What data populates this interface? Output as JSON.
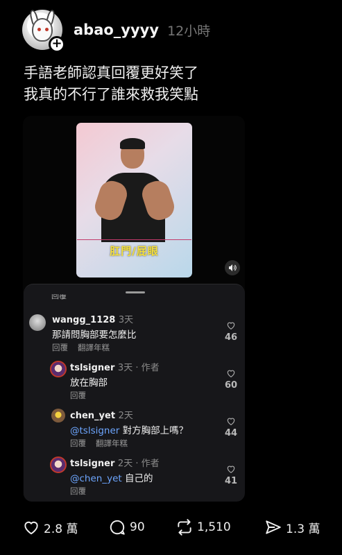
{
  "post": {
    "username": "abao_yyyy",
    "time": "12小時",
    "text_line1": "手語老師認真回覆更好笑了",
    "text_line2": "我真的不行了誰來救我笑點"
  },
  "video": {
    "caption": "肛門/屁眼"
  },
  "comments_sheet": {
    "cut_label": "回覆",
    "comments": [
      {
        "user": "wangg_1128",
        "meta": "3天",
        "text": "那請問胸部要怎麼比",
        "reply": "回覆",
        "translate": "翻譯年糕",
        "likes": "46"
      },
      {
        "user": "tslsigner",
        "meta": "3天 · 作者",
        "text": "放在胸部",
        "reply": "回覆",
        "likes": "60"
      },
      {
        "user": "chen_yet",
        "meta": "2天",
        "mention": "@tslsigner",
        "text": " 對方胸部上嗎？",
        "reply": "回覆",
        "translate": "翻譯年糕",
        "likes": "44"
      },
      {
        "user": "tslsigner",
        "meta": "2天 · 作者",
        "mention": "@chen_yet",
        "text": " 自己的",
        "reply": "回覆",
        "likes": "41"
      }
    ]
  },
  "actions": {
    "likes": "2.8 萬",
    "comments": "90",
    "reposts": "1,510",
    "shares": "1.3 萬"
  },
  "icons": [
    "plus-icon",
    "volume-icon",
    "heart-icon",
    "comment-icon",
    "repost-icon",
    "share-icon"
  ]
}
